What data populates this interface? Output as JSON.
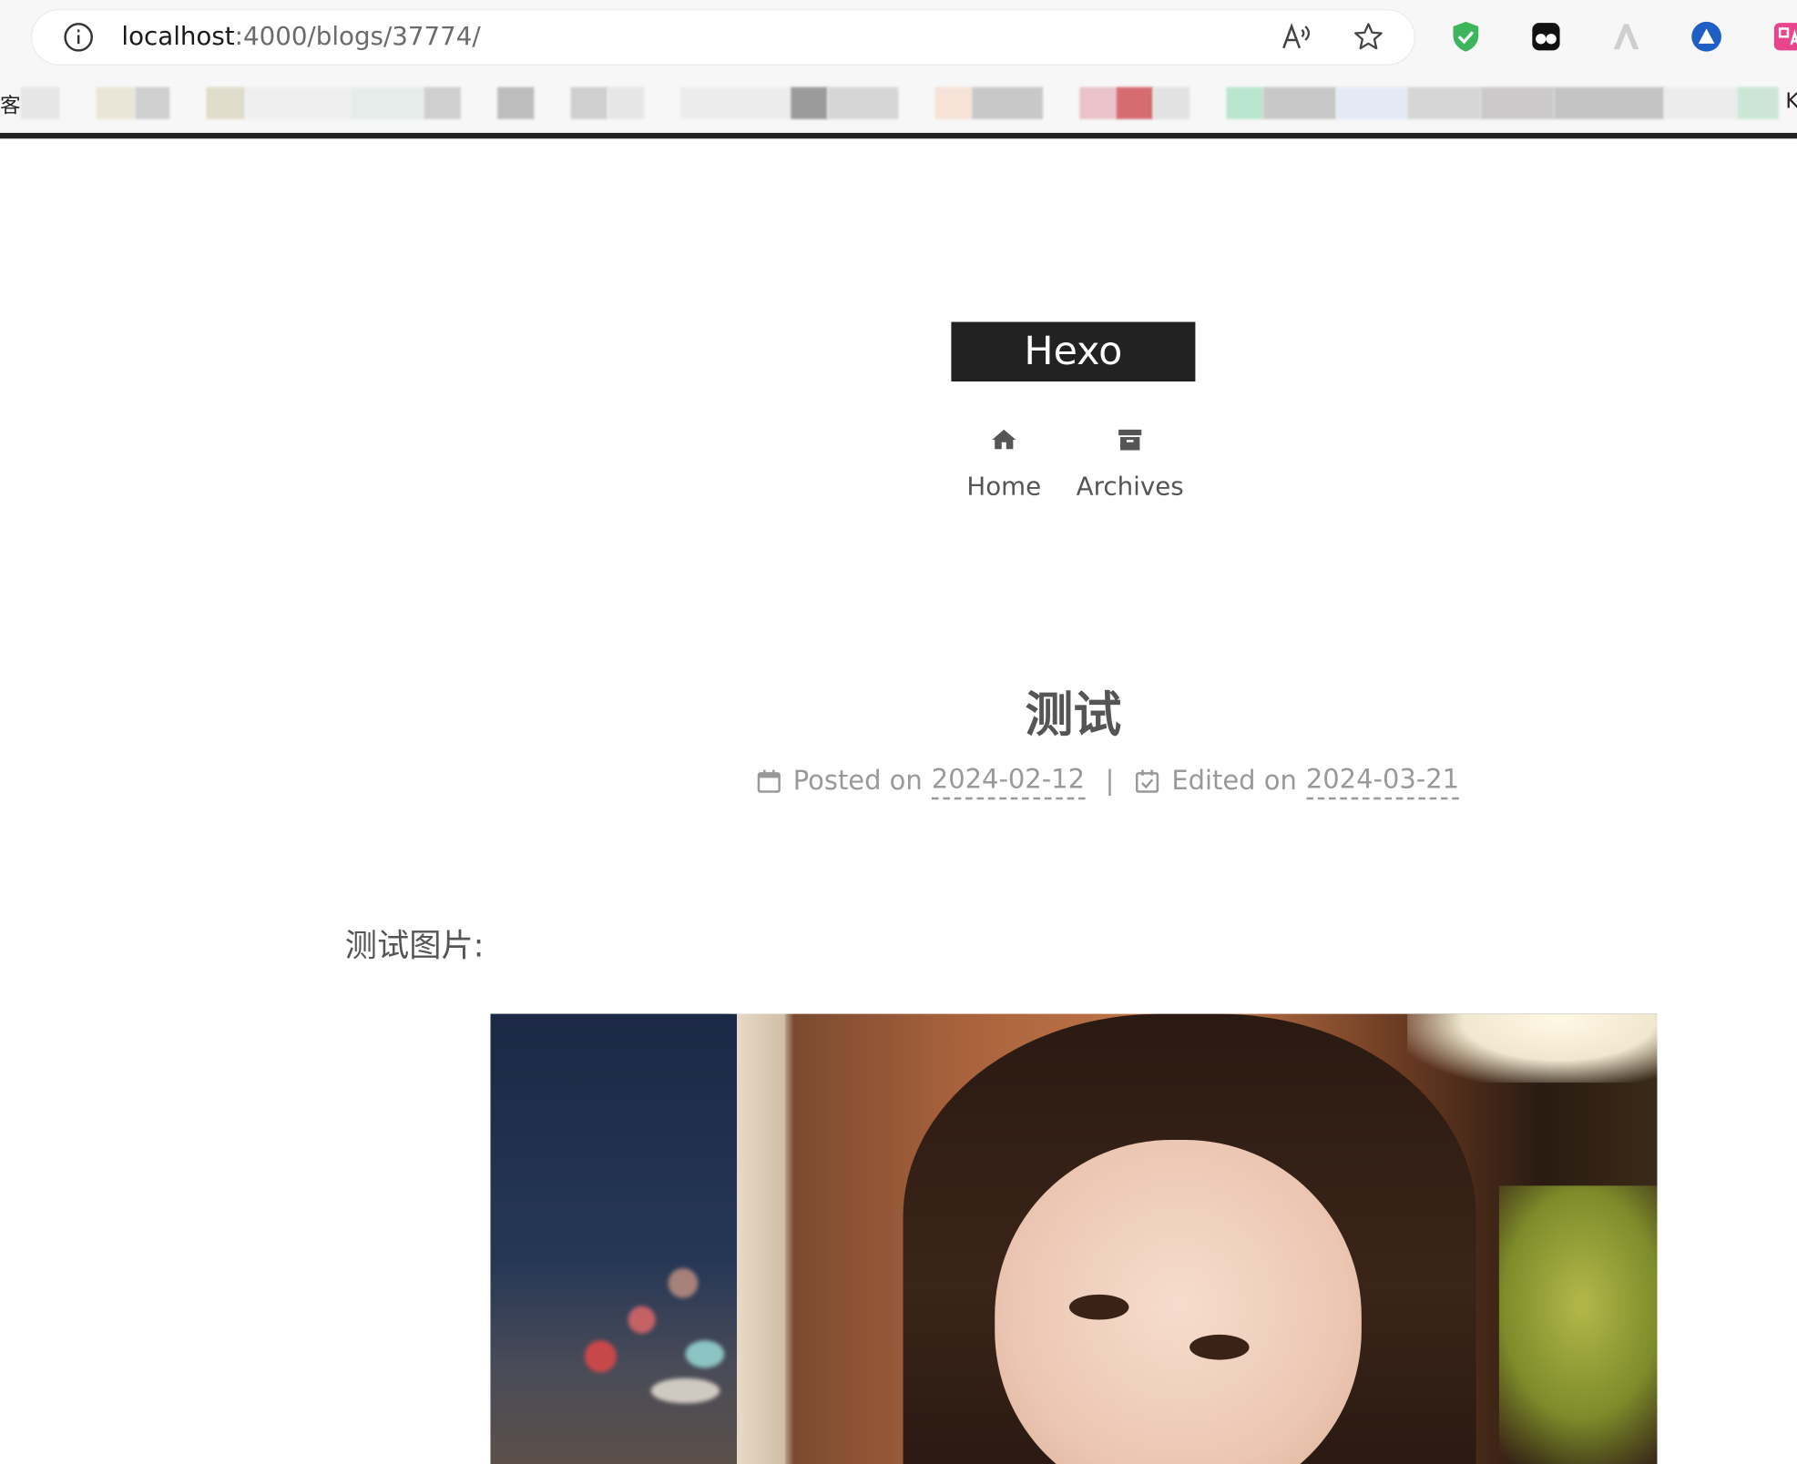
{
  "browser": {
    "url_host": "localhost",
    "url_path": ":4000/blogs/37774/",
    "bookmarks_left_edge_char": "客",
    "bookmarks_right_edge_char": "K"
  },
  "site": {
    "brand": "Hexo",
    "menu": [
      {
        "label": "Home",
        "icon": "home-icon"
      },
      {
        "label": "Archives",
        "icon": "archive-icon"
      }
    ]
  },
  "post": {
    "title": "测试",
    "posted_label": "Posted on",
    "posted_date": "2024-02-12",
    "separator": "|",
    "edited_label": "Edited on",
    "edited_date": "2024-03-21",
    "body_text": "测试图片:"
  },
  "colors": {
    "brand_bg": "#222222",
    "text": "#555555",
    "meta_text": "#999999"
  }
}
